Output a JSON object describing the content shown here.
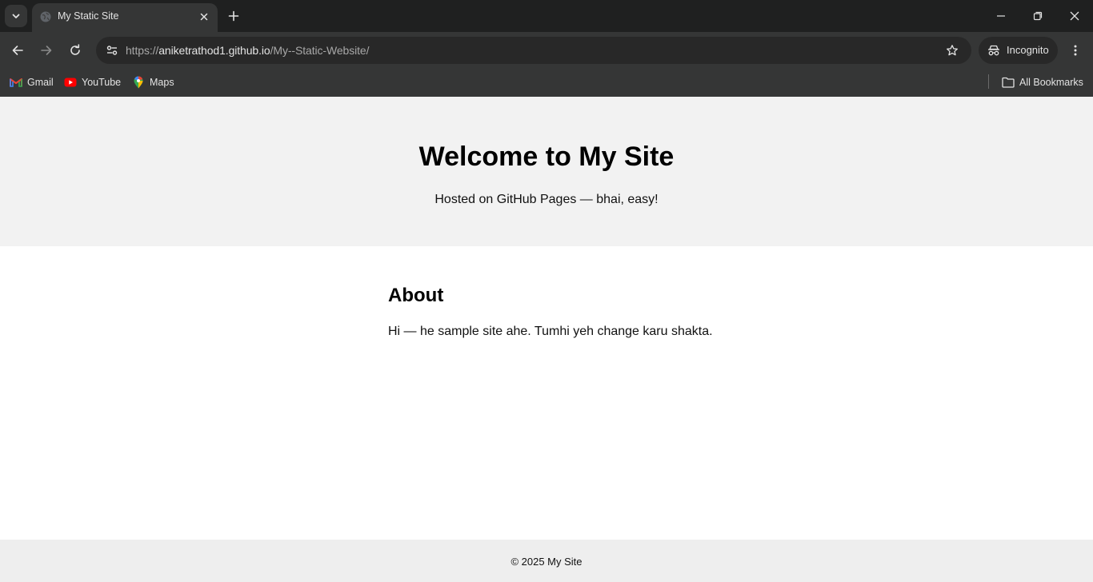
{
  "browser": {
    "tab": {
      "title": "My Static Site"
    },
    "address": {
      "scheme": "https://",
      "host": "aniketrathod1.github.io",
      "path": "/My--Static-Website/"
    },
    "profile": {
      "label": "Incognito"
    },
    "bookmarks": [
      {
        "label": "Gmail",
        "icon": "gmail-icon"
      },
      {
        "label": "YouTube",
        "icon": "youtube-icon"
      },
      {
        "label": "Maps",
        "icon": "maps-icon"
      }
    ],
    "all_bookmarks_label": "All Bookmarks"
  },
  "page": {
    "hero": {
      "title": "Welcome to My Site",
      "subtitle": "Hosted on GitHub Pages — bhai, easy!"
    },
    "about": {
      "heading": "About",
      "text": "Hi — he sample site ahe. Tumhi yeh change karu shakta."
    },
    "footer": {
      "text": "© 2025 My Site"
    }
  },
  "colors": {
    "chrome_dark": "#1f2020",
    "chrome_toolbar": "#353636",
    "hero_bg": "#f2f2f2",
    "footer_bg": "#eeeeee"
  }
}
